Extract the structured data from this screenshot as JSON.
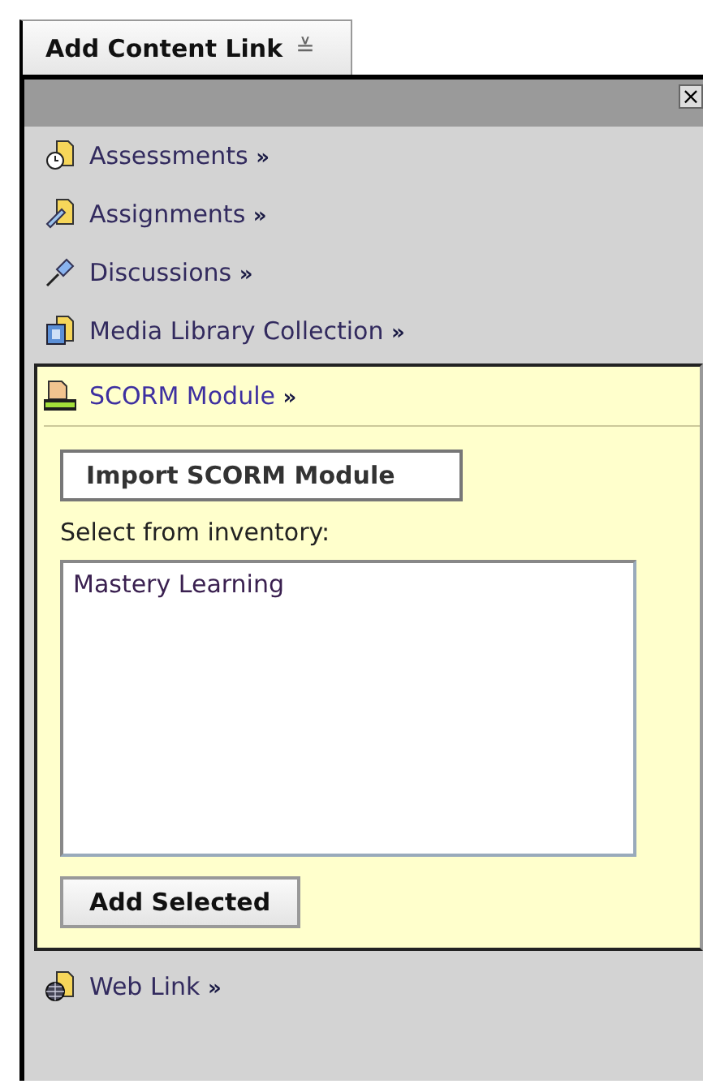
{
  "tab": {
    "label": "Add Content Link",
    "menu_glyph": "≚"
  },
  "panel": {
    "close": "×"
  },
  "items": [
    {
      "label": "Assessments",
      "arrow": "»",
      "expanded": false
    },
    {
      "label": "Assignments",
      "arrow": "»",
      "expanded": false
    },
    {
      "label": "Discussions",
      "arrow": "»",
      "expanded": false
    },
    {
      "label": "Media Library Collection",
      "arrow": "»",
      "expanded": false
    },
    {
      "label": "SCORM Module",
      "arrow": "»",
      "expanded": true
    },
    {
      "label": "Web Link",
      "arrow": "»",
      "expanded": false
    }
  ],
  "scorm": {
    "import_button": "Import SCORM Module",
    "inventory_label": "Select from inventory:",
    "inventory": [
      {
        "label": "Mastery Learning",
        "selected": false
      }
    ],
    "add_button": "Add Selected"
  }
}
